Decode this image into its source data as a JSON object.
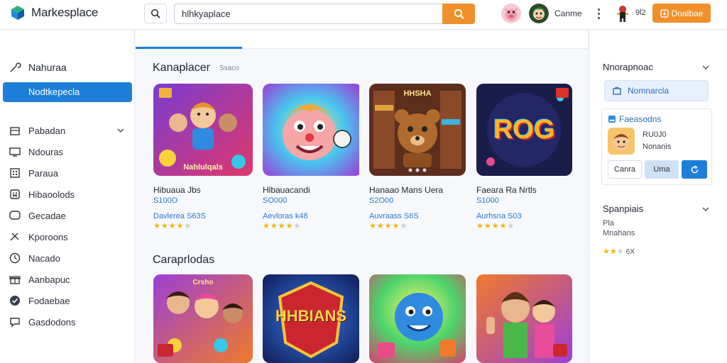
{
  "header": {
    "app_title": "Markesplace",
    "search_value": "hlhkyaplace",
    "game_label": "Canme",
    "count_label": "9l2",
    "download_label": "Doalbae"
  },
  "sidebar": {
    "top_label": "Nahuraa",
    "active_label": "Nodtkepecla",
    "items": [
      {
        "label": "Pabadan",
        "icon": "store-icon"
      },
      {
        "label": "Ndouras",
        "icon": "monitor-icon"
      },
      {
        "label": "Paraua",
        "icon": "building-icon"
      },
      {
        "label": "Hibaoolods",
        "icon": "bookmark-icon"
      },
      {
        "label": "Gecadae",
        "icon": "chat-icon"
      },
      {
        "label": "Kporoons",
        "icon": "tools-icon"
      },
      {
        "label": "Nacado",
        "icon": "clock-icon"
      },
      {
        "label": "Aanbapuc",
        "icon": "gift-icon"
      },
      {
        "label": "Fodaebae",
        "icon": "check-circle-icon"
      },
      {
        "label": "Gasdodons",
        "icon": "comment-icon"
      }
    ]
  },
  "main": {
    "section1": {
      "title": "Kanaplacer",
      "subtitle": "Ssaco",
      "cards": [
        {
          "title": "Hibuaua Jbs",
          "price": "S100O",
          "meta": "Davlerea S63S",
          "rating": 4,
          "art_text": "Nahlulqals"
        },
        {
          "title": "Hlbauacandi",
          "price": "SO000",
          "meta": "Aevloras k48",
          "rating": 4,
          "art_text": ""
        },
        {
          "title": "Hanaao Mans Uera",
          "price": "S2O00",
          "meta": "Auvraass S6S",
          "rating": 4,
          "art_text": "HHSHA"
        },
        {
          "title": "Faeara Ra Nrtls",
          "price": "S1000",
          "meta": "Aurhsna S03",
          "rating": 4,
          "art_text": "ROG"
        }
      ]
    },
    "section2": {
      "title": "Caraprlodas",
      "cards": [
        {
          "art_text": "Crsho"
        },
        {
          "art_text": "HHBIANS"
        },
        {
          "art_text": ""
        },
        {
          "art_text": ""
        }
      ]
    }
  },
  "right_panel": {
    "title1": "Nnorapnoac",
    "chip_label": "Nomnarcla",
    "card_header": "Faeasodns",
    "card_line1": "RU0J0",
    "card_line2": "Nonanis",
    "btn_cancel": "Canra",
    "btn_mid": "Uma",
    "title2": "Spanpiais",
    "sub1": "Pla",
    "sub2": "Mnahans",
    "rating_text": "6X"
  },
  "colors": {
    "accent_blue": "#1e7fd9",
    "accent_orange": "#f0902a",
    "star": "#f1b20b"
  }
}
